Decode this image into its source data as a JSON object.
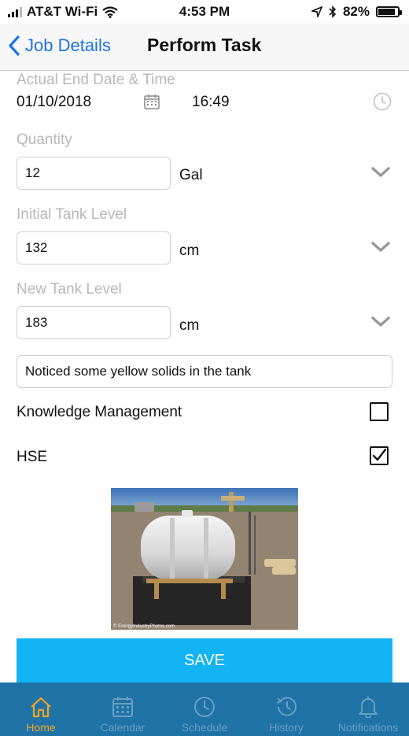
{
  "status_bar": {
    "carrier": "AT&T Wi-Fi",
    "time": "4:53 PM",
    "battery": "82%"
  },
  "nav": {
    "back_label": "Job Details",
    "title": "Perform Task"
  },
  "form": {
    "end_datetime": {
      "label": "Actual End Date & Time",
      "date": "01/10/2018",
      "time": "16:49"
    },
    "quantity": {
      "label": "Quantity",
      "value": "12",
      "unit": "Gal"
    },
    "initial_tank": {
      "label": "Initial Tank Level",
      "value": "132",
      "unit": "cm"
    },
    "new_tank": {
      "label": "New Tank Level",
      "value": "183",
      "unit": "cm"
    },
    "notes": {
      "value": "Noticed some yellow solids in the tank"
    },
    "knowledge": {
      "label": "Knowledge Management",
      "checked": false
    },
    "hse": {
      "label": "HSE",
      "checked": true
    },
    "photo": {
      "watermark": "© EnergyIndustryPhotos.com"
    }
  },
  "save_label": "SAVE",
  "tabs": [
    {
      "label": "Home",
      "icon": "home-icon",
      "active": true
    },
    {
      "label": "Calendar",
      "icon": "calendar-icon",
      "active": false
    },
    {
      "label": "Schedule",
      "icon": "clock-icon",
      "active": false
    },
    {
      "label": "History",
      "icon": "history-icon",
      "active": false
    },
    {
      "label": "Notifications",
      "icon": "bell-icon",
      "active": false
    }
  ],
  "colors": {
    "accent": "#1a73e8",
    "save": "#12b4f4",
    "tabbar": "#1f73a7",
    "tab_active": "#f5a623",
    "tab_inactive": "#6a9fc2"
  }
}
